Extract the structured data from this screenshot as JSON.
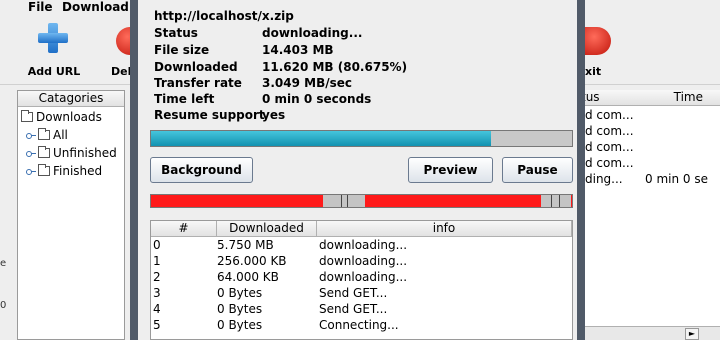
{
  "main": {
    "menu": [
      "File",
      "Download"
    ],
    "toolbar": {
      "add_url_label": "Add URL",
      "delete_label": "Del",
      "exit_label": "xit"
    },
    "categories": {
      "header": "Catagories",
      "root": "Downloads",
      "items": [
        "All",
        "Unfinished",
        "Finished"
      ]
    },
    "download_list": {
      "headers": [
        "tus",
        "Time"
      ],
      "rows": [
        {
          "status": "d com...",
          "time": ""
        },
        {
          "status": "d com...",
          "time": ""
        },
        {
          "status": "d com...",
          "time": ""
        },
        {
          "status": "d com...",
          "time": ""
        },
        {
          "status": "ding...",
          "time": "0 min 0 se"
        }
      ]
    },
    "left_edge_text": [
      "e",
      "0"
    ]
  },
  "dialog": {
    "url": "http://localhost/x.zip",
    "info": [
      {
        "label": "Status",
        "value": "downloading..."
      },
      {
        "label": "File size",
        "value": "14.403 MB"
      },
      {
        "label": "Downloaded",
        "value": "11.620 MB (80.675%)"
      },
      {
        "label": "Transfer rate",
        "value": "3.049 MB/sec"
      },
      {
        "label": "Time left",
        "value": "0 min 0 seconds"
      },
      {
        "label": "Resume support",
        "value": "yes"
      }
    ],
    "progress_fraction": 0.80675,
    "buttons": {
      "background": "Background",
      "preview": "Preview",
      "pause": "Pause"
    },
    "table": {
      "headers": [
        "#",
        "Downloaded",
        "info"
      ],
      "rows": [
        {
          "id": "0",
          "downloaded": "5.750 MB",
          "info": "downloading..."
        },
        {
          "id": "1",
          "downloaded": "256.000 KB",
          "info": "downloading..."
        },
        {
          "id": "2",
          "downloaded": "64.000 KB",
          "info": "downloading..."
        },
        {
          "id": "3",
          "downloaded": "0 Bytes",
          "info": "Send GET..."
        },
        {
          "id": "4",
          "downloaded": "0 Bytes",
          "info": "Send GET..."
        },
        {
          "id": "5",
          "downloaded": "0 Bytes",
          "info": "Connecting..."
        }
      ]
    }
  },
  "colors": {
    "progress": "#1fa6c4",
    "segment": "#ff1a1a",
    "dialog_frame": "#505a68"
  }
}
